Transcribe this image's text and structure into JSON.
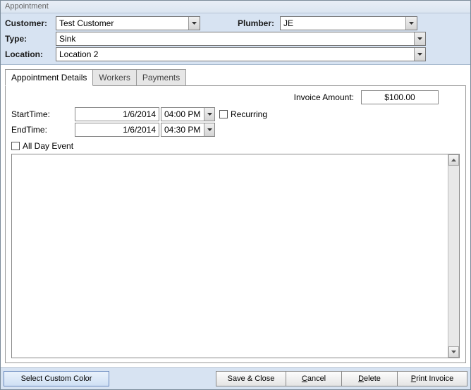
{
  "window": {
    "title": "Appointment"
  },
  "header": {
    "customer_label": "Customer:",
    "customer_value": "Test Customer",
    "plumber_label": "Plumber:",
    "plumber_value": "JE",
    "type_label": "Type:",
    "type_value": "Sink",
    "location_label": "Location:",
    "location_value": "Location 2"
  },
  "tabs": {
    "details": "Appointment Details",
    "workers": "Workers",
    "payments": "Payments"
  },
  "details": {
    "invoice_label": "Invoice Amount:",
    "invoice_value": "$100.00",
    "start_label": "StartTime:",
    "start_date": "1/6/2014",
    "start_time": "04:00 PM",
    "end_label": "EndTime:",
    "end_date": "1/6/2014",
    "end_time": "04:30 PM",
    "recurring_label": "Recurring",
    "allday_label": "All Day Event",
    "notes": ""
  },
  "footer": {
    "color": "Select Custom Color",
    "save": "Save & Close",
    "cancel": "Cancel",
    "delete": "Delete",
    "print": "Print Invoice"
  }
}
